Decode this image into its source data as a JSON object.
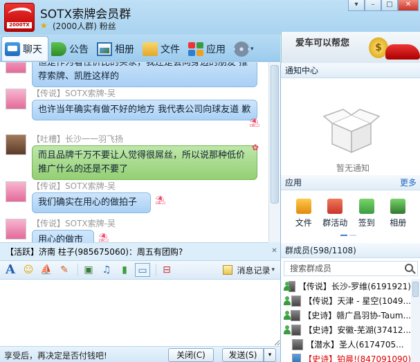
{
  "window": {
    "title": "SOTX索牌会员群",
    "subtitle": "(2000人群) 粉丝",
    "logo_text": "2000TX"
  },
  "tabs": [
    {
      "label": "聊天"
    },
    {
      "label": "公告"
    },
    {
      "label": "相册"
    },
    {
      "label": "文件"
    },
    {
      "label": "应用"
    }
  ],
  "ad": {
    "text": "爱车可以帮您",
    "coin": "$"
  },
  "messages": [
    {
      "sender": "",
      "text": "但是作为着性价比的买家，我还是会向身边的朋友 推荐索牌、凯胜这样的"
    },
    {
      "sender": "【传说】SOTX索牌-吴",
      "text": "也许当年确实有做不好的地方 我代表公司向球友道 歉"
    },
    {
      "sender": "【吐槽】长沙一一羽飞扬",
      "text": "而且品牌千万不要让人觉得很屌丝，所以说那种低价 推广什么的还是不要了"
    },
    {
      "sender": "【传说】SOTX索牌-吴",
      "text": "我们确实在用心的做拍子"
    },
    {
      "sender": "【传说】SOTX索牌-吴",
      "text": "用心的做市场"
    }
  ],
  "activity": {
    "text": "【活跃】济南 柱子(985675060)：周五有团购?"
  },
  "toolbar": {
    "history_label": "消息记录"
  },
  "bottom": {
    "hint": "享受后，再决定是否付钱吧!",
    "close_label": "关闭(C)",
    "send_label": "发送(S)"
  },
  "right": {
    "notice_title": "通知中心",
    "notice_empty": "暂无通知",
    "apps_title": "应用",
    "apps_more": "更多",
    "apps": [
      {
        "label": "文件",
        "color": "#f0a020"
      },
      {
        "label": "群活动",
        "color": "#e2553a"
      },
      {
        "label": "签到",
        "color": "#4caf3a"
      },
      {
        "label": "相册",
        "color": "#3a9c3e"
      }
    ],
    "members_title": "群成员(598/1108)",
    "search_placeholder": "搜索群成员",
    "members": [
      {
        "tag": "【传说】",
        "name": "长沙-罗维(6191921)"
      },
      {
        "tag": "【传说】",
        "name": "天津 - 星空(1049..."
      },
      {
        "tag": "【史诗】",
        "name": "赣广昌羽协-Taum..."
      },
      {
        "tag": "【史诗】",
        "name": "安徽-芜湖(37412..."
      },
      {
        "tag": "【潜水】",
        "name": "圣人(6174705..."
      },
      {
        "tag": "【史诗】",
        "name": "铂晨!(847091090)"
      }
    ]
  }
}
